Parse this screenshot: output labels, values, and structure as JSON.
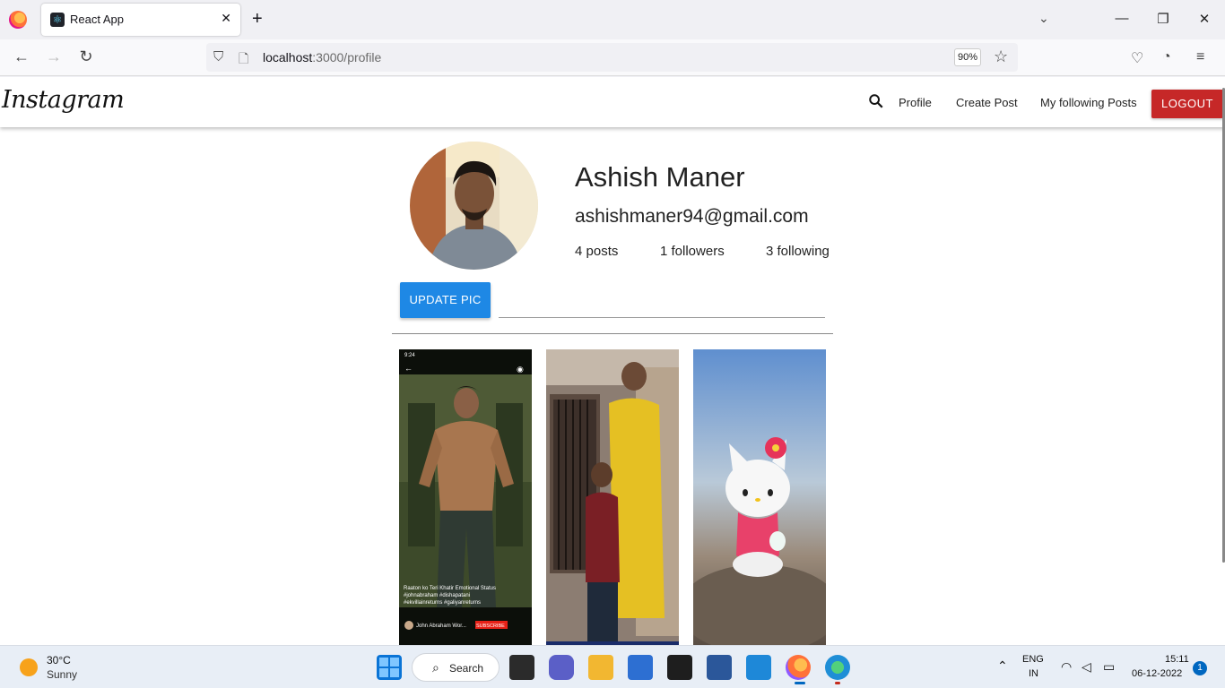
{
  "browser": {
    "tab_title": "React App",
    "url_host": "localhost",
    "url_rest": ":3000/profile",
    "zoom": "90%"
  },
  "app": {
    "brand": "Instagram",
    "nav": {
      "profile": "Profile",
      "create_post": "Create Post",
      "following_posts": "My following Posts",
      "logout": "LOGOUT"
    }
  },
  "profile": {
    "name": "Ashish Maner",
    "email": "ashishmaner94@gmail.com",
    "posts": "4 posts",
    "followers": "1 followers",
    "following": "3 following",
    "update_pic": "UPDATE PIC"
  },
  "posts": [
    {
      "caption": "Raaton ko Teri Khatir Emotional Status #johnabraham #dishapatani #ekvillainreturns #galiyanreturns",
      "channel": "John Abraham Wor...",
      "subscribe": "SUBSCRIBE",
      "time": "9:24"
    },
    {
      "caption": ""
    },
    {
      "caption": ""
    }
  ],
  "taskbar": {
    "temp": "30°C",
    "condition": "Sunny",
    "search": "Search",
    "lang1": "ENG",
    "lang2": "IN",
    "time": "15:11",
    "date": "06-12-2022",
    "notifications": "1"
  }
}
